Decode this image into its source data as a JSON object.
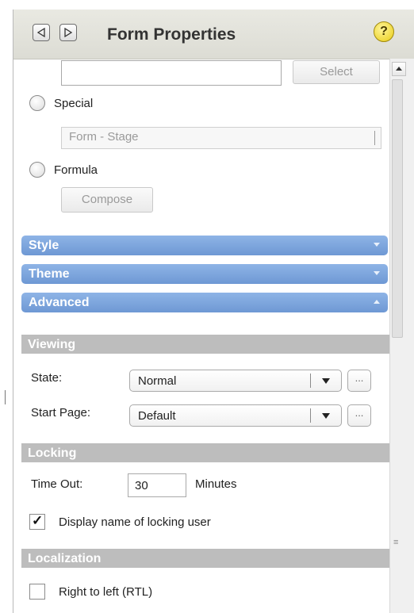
{
  "header": {
    "title": "Form Properties",
    "help_label": "?",
    "back_icon": "back-arrow-icon",
    "forward_icon": "forward-arrow-icon"
  },
  "source": {
    "input_value": "",
    "select_label": "Select",
    "special_label": "Special",
    "special_value": "Form - Stage",
    "formula_label": "Formula",
    "compose_label": "Compose"
  },
  "accordion": {
    "style": "Style",
    "theme": "Theme",
    "advanced": "Advanced"
  },
  "viewing": {
    "title": "Viewing",
    "state_label": "State:",
    "state_value": "Normal",
    "start_page_label": "Start Page:",
    "start_page_value": "Default",
    "ellipsis": "..."
  },
  "locking": {
    "title": "Locking",
    "timeout_label": "Time Out:",
    "timeout_value": "30",
    "timeout_unit": "Minutes",
    "display_name_label": "Display name of locking user",
    "display_name_checked": true
  },
  "localization": {
    "title": "Localization",
    "rtl_label": "Right to left (RTL)",
    "rtl_checked": false
  },
  "colors": {
    "accordion_blue": "#7ea6de",
    "section_gray": "#bdbdbd",
    "help_yellow": "#f3dd3a"
  }
}
